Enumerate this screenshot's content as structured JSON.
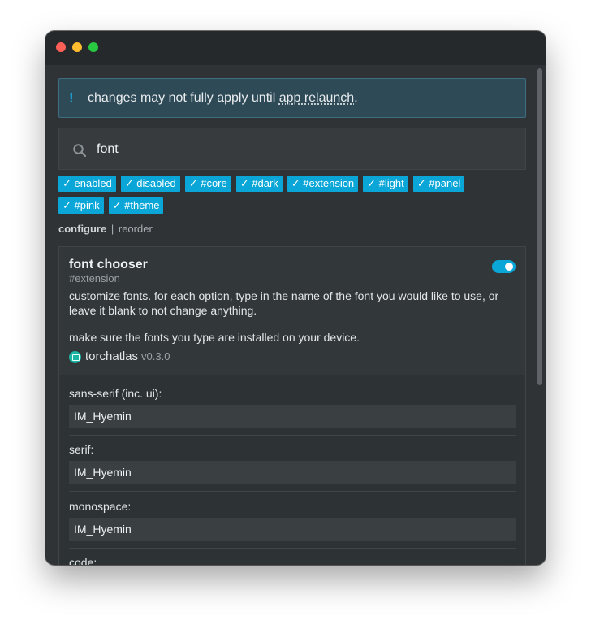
{
  "notice": {
    "text_before": "changes may not fully apply until ",
    "link": "app relaunch",
    "text_after": ".",
    "icon": "exclamation-icon"
  },
  "search": {
    "value": "font",
    "icon": "search-icon"
  },
  "tags": [
    "✓ enabled",
    "✓ disabled",
    "✓ #core",
    "✓ #dark",
    "✓ #extension",
    "✓ #light",
    "✓ #panel",
    "✓ #pink",
    "✓ #theme"
  ],
  "views": {
    "configure": "configure",
    "separator": "|",
    "reorder": "reorder"
  },
  "extension": {
    "title": "font chooser",
    "tag": "#extension",
    "enabled": true,
    "description_1": "customize fonts. for each option, type in the name of the font you would like to use, or leave it blank to not change anything.",
    "description_2": "make sure the fonts you type are installed on your device.",
    "author": "torchatlas",
    "version": "v0.3.0"
  },
  "options": [
    {
      "label": "sans-serif (inc. ui):",
      "value": "IM_Hyemin"
    },
    {
      "label": "serif:",
      "value": "IM_Hyemin"
    },
    {
      "label": "monospace:",
      "value": "IM_Hyemin"
    },
    {
      "label": "code:",
      "value": ""
    }
  ],
  "colors": {
    "accent": "#0aa6d8",
    "window_bg": "#2f3335",
    "notice_bg": "#2f4a57"
  }
}
